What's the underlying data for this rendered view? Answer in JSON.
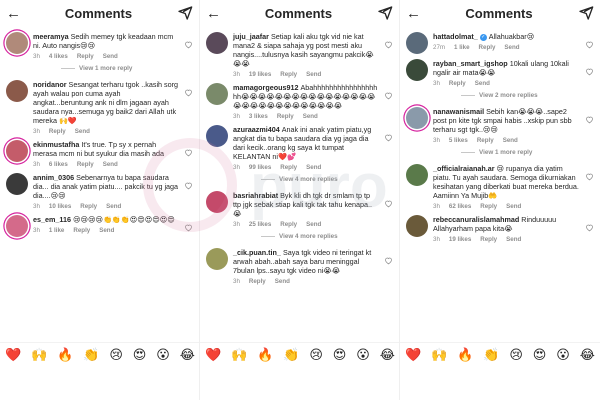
{
  "header": {
    "title": "Comments",
    "back_icon": "back-arrow-icon",
    "send_icon": "paper-plane-icon"
  },
  "labels": {
    "reply": "Reply",
    "send": "Send"
  },
  "emoji_bar": [
    "❤️",
    "🙌",
    "🔥",
    "👏",
    "😢",
    "😍",
    "😮",
    "😂"
  ],
  "panels": [
    {
      "items": [
        {
          "type": "comment",
          "username": "meeramya",
          "text": "Sedih memey tgk keadaan mcm ni. Auto nangis😢😢",
          "time": "3h",
          "likes": "4 likes",
          "avatar": "#b08a7a",
          "ring": true
        },
        {
          "type": "more",
          "text": "View 1 more reply"
        },
        {
          "type": "comment",
          "username": "noridanor",
          "text": "Sesangat terharu tgok ..kasih sorg ayah walau pon cuma ayah angkat...beruntung ank ni dlm jagaan ayah saudara nya...semuga yg baik2 dari Allah utk mereka 🙌❤️",
          "time": "3h",
          "likes": "",
          "avatar": "#8b5a4a",
          "ring": false
        },
        {
          "type": "comment",
          "username": "ekinmustafha",
          "text": "It's true. Tp sy x pernah merasa mcm ni but syukur dia masih ada",
          "time": "3h",
          "likes": "6 likes",
          "avatar": "#c45c6a",
          "ring": true
        },
        {
          "type": "comment",
          "username": "annim_0306",
          "text": "Sebenarnya tu bapa saudara dia... dia anak yatim piatu.... pakcik tu yg jaga dia....😢😢",
          "time": "3h",
          "likes": "10 likes",
          "avatar": "#3a3a3a",
          "ring": false
        },
        {
          "type": "comment",
          "username": "es_em_116",
          "text": "😢😢😢😢👏👏👏😍😍😍😍😍😍",
          "time": "3h",
          "likes": "1 like",
          "avatar": "#d46a8a",
          "ring": true
        }
      ]
    },
    {
      "items": [
        {
          "type": "comment",
          "username": "juju_jaafar",
          "text": "Setiap kali aku tgk vid nie kat mana2 & siapa sahaja yg post mesti aku nangis....tulusnya kasih sayangmu pakcik😭😭😭",
          "time": "3h",
          "likes": "19 likes",
          "avatar": "#5a4a5a",
          "ring": false
        },
        {
          "type": "comment",
          "username": "mamagorgeous912",
          "text": "Abahhhhhhhhhhhhhhhhhh😭😭😭😭😭😭😭😭😭😭😭😭😭😭😭😭😭😭😭😭😭😭😭😭😭😭😭😭😭",
          "time": "3h",
          "likes": "3 likes",
          "avatar": "#7a8a6a",
          "ring": false
        },
        {
          "type": "comment",
          "username": "azuraazmi404",
          "text": "Anak ini anak yatim piatu,yg angkat dia tu bapa saudara dia yg jaga dia dari kecik..orang kg saya kt tumpat KELANTAN ni❤️💕",
          "time": "3h",
          "likes": "99 likes",
          "avatar": "#4a5a8a",
          "ring": false
        },
        {
          "type": "more",
          "text": "View 4 more replies"
        },
        {
          "type": "comment",
          "username": "basriahrabiat",
          "text": "Byk kli dh tgk dr smlam tp tp ttp jgk sebak stiap kali tgk tak tahu kenapa..😭",
          "time": "3h",
          "likes": "25 likes",
          "avatar": "#c44a6a",
          "ring": false
        },
        {
          "type": "more",
          "text": "View 4 more replies"
        },
        {
          "type": "comment",
          "username": "_cik.puan.tin_",
          "text": "Saya tgk video ni teringat kt arwah abah..abah saya baru meninggal 7bulan lps..sayu tgk video ni😭😭",
          "time": "3h",
          "likes": "",
          "avatar": "#9a9a5a",
          "ring": false
        }
      ]
    },
    {
      "items": [
        {
          "type": "comment",
          "username": "hattadolmat_",
          "verified": true,
          "text": "Allahuakbar😢",
          "time": "27m",
          "likes": "1 like",
          "avatar": "#5a6a7a",
          "ring": false
        },
        {
          "type": "comment",
          "username": "rayban_smart_igshop",
          "text": "10kali ulang 10kali ngalir air mata😭😭",
          "time": "3h",
          "likes": "",
          "avatar": "#3a4a3a",
          "ring": false
        },
        {
          "type": "more",
          "text": "View 2 more replies"
        },
        {
          "type": "comment",
          "username": "nanawanismail",
          "text": "Sebih kan😭😭😭..sape2 post pn kite tgk smpai habis ..xskip pun sbb terharu sgt tgk..😢😢",
          "time": "3h",
          "likes": "5 likes",
          "avatar": "#8a9aaa",
          "ring": true
        },
        {
          "type": "more",
          "text": "View 1 more reply"
        },
        {
          "type": "comment",
          "username": "_officialraianah.ar",
          "text": "😢 rupanya dia yatim piatu. Tu ayah saudara. Semoga dikurniakan kesihatan yang diberkati buat mereka berdua. Aamiinn Ya Mujib🤲",
          "time": "3h",
          "likes": "62 likes",
          "avatar": "#5a7a4a",
          "ring": false
        },
        {
          "type": "comment",
          "username": "rebeccanuralislamahmad",
          "text": "Rinduuuuu Allahyarham papa kita😭",
          "time": "3h",
          "likes": "19 likes",
          "avatar": "#6a5a3a",
          "ring": false
        }
      ]
    }
  ]
}
